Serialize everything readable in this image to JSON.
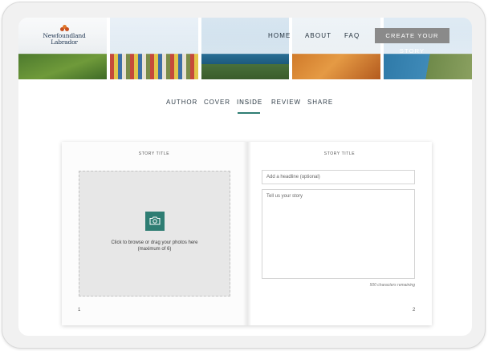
{
  "brand": {
    "logo_line1": "Newfoundland",
    "logo_line2": "Labrador",
    "accent_color": "#2e7d73"
  },
  "nav": {
    "home": "HOME",
    "about": "ABOUT",
    "faq": "FAQ",
    "cta": "CREATE YOUR STORY"
  },
  "steps": [
    {
      "label": "AUTHOR",
      "active": false
    },
    {
      "label": "COVER",
      "active": false
    },
    {
      "label": "INSIDE",
      "active": true
    },
    {
      "label": "REVIEW",
      "active": false
    },
    {
      "label": "SHARE",
      "active": false
    }
  ],
  "book": {
    "left_page": {
      "title": "STORY TITLE",
      "upload_icon": "camera-icon",
      "upload_line1": "Click to browse or drag your photos here",
      "upload_line2": "(maximum of 6)",
      "page_number": "1"
    },
    "right_page": {
      "title": "STORY TITLE",
      "headline_placeholder": "Add a headline (optional)",
      "story_placeholder": "Tell us your story",
      "chars_remaining": "500 characters remaining",
      "page_number": "2"
    }
  }
}
